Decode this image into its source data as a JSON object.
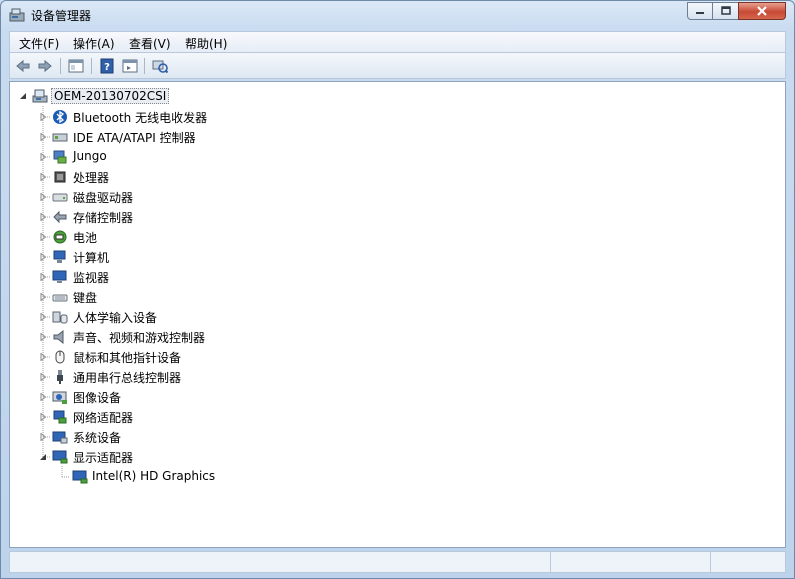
{
  "window": {
    "title": "设备管理器"
  },
  "menubar": {
    "items": [
      {
        "label": "文件(F)"
      },
      {
        "label": "操作(A)"
      },
      {
        "label": "查看(V)"
      },
      {
        "label": "帮助(H)"
      }
    ]
  },
  "toolbar": {
    "buttons": [
      "back-arrow-icon",
      "forward-arrow-icon",
      "properties-icon",
      "help-icon",
      "view-icon",
      "scan-hardware-icon"
    ]
  },
  "tree": {
    "root": {
      "label": "OEM-20130702CSI",
      "expanded": true
    },
    "categories": [
      {
        "label": "Bluetooth 无线电收发器",
        "icon": "bluetooth-icon",
        "expanded": false
      },
      {
        "label": "IDE ATA/ATAPI 控制器",
        "icon": "ide-controller-icon",
        "expanded": false
      },
      {
        "label": "Jungo",
        "icon": "jungo-icon",
        "expanded": false
      },
      {
        "label": "处理器",
        "icon": "processor-icon",
        "expanded": false
      },
      {
        "label": "磁盘驱动器",
        "icon": "disk-drive-icon",
        "expanded": false
      },
      {
        "label": "存储控制器",
        "icon": "storage-controller-icon",
        "expanded": false
      },
      {
        "label": "电池",
        "icon": "battery-icon",
        "expanded": false
      },
      {
        "label": "计算机",
        "icon": "computer-icon",
        "expanded": false
      },
      {
        "label": "监视器",
        "icon": "monitor-icon",
        "expanded": false
      },
      {
        "label": "键盘",
        "icon": "keyboard-icon",
        "expanded": false
      },
      {
        "label": "人体学输入设备",
        "icon": "hid-icon",
        "expanded": false
      },
      {
        "label": "声音、视频和游戏控制器",
        "icon": "sound-icon",
        "expanded": false
      },
      {
        "label": "鼠标和其他指针设备",
        "icon": "mouse-icon",
        "expanded": false
      },
      {
        "label": "通用串行总线控制器",
        "icon": "usb-icon",
        "expanded": false
      },
      {
        "label": "图像设备",
        "icon": "camera-icon",
        "expanded": false
      },
      {
        "label": "网络适配器",
        "icon": "network-adapter-icon",
        "expanded": false
      },
      {
        "label": "系统设备",
        "icon": "system-device-icon",
        "expanded": false
      },
      {
        "label": "显示适配器",
        "icon": "display-adapter-icon",
        "expanded": true,
        "children": [
          {
            "label": "Intel(R) HD Graphics",
            "icon": "display-adapter-icon"
          }
        ]
      }
    ]
  },
  "colors": {
    "accent": "#3a6ea5",
    "close": "#c74a35"
  }
}
